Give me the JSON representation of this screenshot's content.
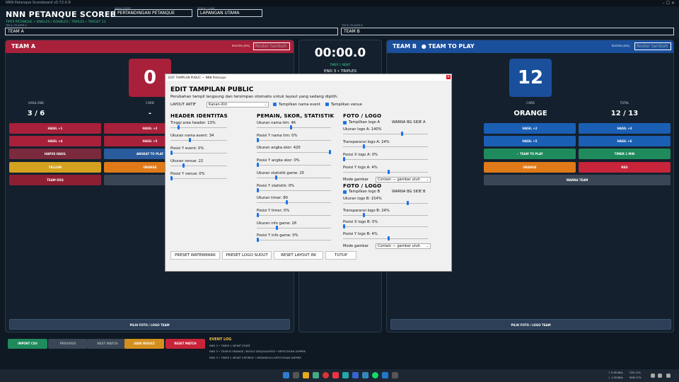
{
  "window": {
    "title": "NNN Petanque Scoreboard v0.72-0.8",
    "controls": "–  ☐  ✕"
  },
  "header": {
    "title": "NNN PETANQUE SCOREBOARD",
    "subtitle": "TIPEP PETANQUE • SINGLES / DOUBLES / TRIPLES • TARGET 13",
    "event_label": "NAMA EVENT",
    "event_value": "PERTANDINGAN PETANQUE",
    "venue_label": "VENUE / LANE",
    "venue_value": "LAPANGAN UTAMA",
    "team_a_label": "TIM A / PLAYER A",
    "team_a_value": "TEAM A",
    "team_b_label": "TIM B / PLAYER B",
    "team_b_value": "TEAM B"
  },
  "team_a": {
    "name": "TEAM A",
    "roster_label": "ROSTER (OPS)",
    "roster_placeholder": "Roster tambah",
    "score": "0",
    "stats": [
      {
        "label": "HASIL END",
        "value": "3 / 6"
      },
      {
        "label": "CARD",
        "value": "-"
      }
    ],
    "buttons": [
      "HASIL +1",
      "HASIL +2",
      "HASIL +4",
      "HASIL +5",
      "HAPUS HASIL",
      "ANGKAT TO PLAY",
      "YELLOW",
      "ORANGE",
      "TEAM DSQ"
    ],
    "photo_button": "PILIH FOTO / LOGO TEAM",
    "color": "#a8203a"
  },
  "team_b": {
    "name": "TEAM B",
    "to_play": "● TEAM TO PLAY",
    "roster_label": "ROSTER (OPS)",
    "roster_placeholder": "Roster tambah",
    "score": "12",
    "stats": [
      {
        "label": "CARD",
        "value": "ORANGE"
      },
      {
        "label": "TOTAL",
        "value": "12 / 13"
      }
    ],
    "buttons": [
      "HASIL +2",
      "HASIL +3",
      "HASIL +5",
      "HASIL +6",
      "✓ TEAM TO PLAY",
      "TIMER 1 MIN",
      "ORANGE",
      "RED",
      "WARNA TEAM"
    ],
    "photo_button": "PILIH FOTO / LOGO TEAM",
    "color": "#1a4f9c"
  },
  "center": {
    "timer": "00:00.0",
    "timer_sub": "TIMER 1 MENIT",
    "end_info": "END 3 • TRIPLES"
  },
  "bottom": {
    "buttons": [
      "IMPORT CSV",
      "PREVIOUS",
      "NEXT MATCH",
      "SAVE RESULT",
      "RESET MATCH"
    ],
    "log_title": "EVENT LOG",
    "log_lines": [
      "END 3 • TIMER 1 MENIT START",
      "END 3 • TEAM B ORANGE / BOULE DISQUALIFIED • KEPUTUSAN UMPIRE",
      "END 3 • TIMER 1 MENIT EXPIRED • MENUNGGU KEPUTUSAN UMPIRE"
    ]
  },
  "dialog": {
    "title": "EDIT TAMPILAN PUBLIC — NNN Petanque",
    "close": "✕",
    "heading": "EDIT TAMPILAN PUBLIC",
    "description": "Perubahan tampil langsung dan tersimpan otomatis untuk layout yang sedang dipilih.",
    "layout_label": "LAYOUT AKTIF",
    "layout_value": "Kanan–Kiri",
    "show_event": "Tampilkan nama event",
    "show_venue": "Tampilkan venue",
    "col1": {
      "heading": "HEADER IDENTITAS",
      "items": [
        {
          "label": "Tinggi area header: 13%",
          "level": 0.13
        },
        {
          "label": "Ukuran nama event: 34",
          "level": 0.34
        },
        {
          "label": "Posisi Y event: 0%",
          "level": 0.0
        },
        {
          "label": "Ukuran venue: 22",
          "level": 0.22
        },
        {
          "label": "Posisi Y venue: 0%",
          "level": 0.0
        }
      ]
    },
    "col2": {
      "heading": "PEMAIN, SKOR, STATISTIK",
      "items": [
        {
          "label": "Ukuran nama tim: 46",
          "level": 0.46
        },
        {
          "label": "Posisi Y nama tim: 0%",
          "level": 0.0
        },
        {
          "label": "Ukuran angka skor: 420",
          "level": 1.0
        },
        {
          "label": "Posisi Y angka skor: 0%",
          "level": 0.0
        },
        {
          "label": "Ukuran statistik game: 25",
          "level": 0.25
        },
        {
          "label": "Posisi Y statistik: 0%",
          "level": 0.0
        },
        {
          "label": "Ukuran timer: 80",
          "level": 0.4
        },
        {
          "label": "Posisi Y timer: 0%",
          "level": 0.0
        },
        {
          "label": "Ukuran info game: 26",
          "level": 0.26
        },
        {
          "label": "Posisi Y info game: 0%",
          "level": 0.0
        }
      ]
    },
    "col3a": {
      "heading": "FOTO / LOGO",
      "show_logo": "Tampilkan logo A",
      "bg_label": "WARNA BG SIDE A",
      "items": [
        {
          "label": "Ukuran logo A: 140%",
          "level": 0.7
        },
        {
          "label": "Transparansi logo A: 24%",
          "level": 0.24
        },
        {
          "label": "Posisi X logo A: 0%",
          "level": 0.0
        },
        {
          "label": "Posisi Y logo A: 4%",
          "level": 0.54
        }
      ],
      "mode_label": "Mode gambar",
      "mode_value": "Contain — gambar utuh"
    },
    "col3b": {
      "heading": "FOTO / LOGO",
      "show_logo": "Tampilkan logo B",
      "bg_label": "WARNA BG SIDE B",
      "items": [
        {
          "label": "Ukuran logo B: 154%",
          "level": 0.77
        },
        {
          "label": "Transparansi logo B: 24%",
          "level": 0.24
        },
        {
          "label": "Posisi X logo B: 0%",
          "level": 0.0
        },
        {
          "label": "Posisi Y logo B: 4%",
          "level": 0.54
        }
      ],
      "mode_label": "Mode gambar",
      "mode_value": "Contain — gambar utuh"
    },
    "buttons": [
      "PRESET WATERMARK",
      "PRESET LOGO SUDUT",
      "RESET LAYOUT INI",
      "TUTUP"
    ]
  },
  "taskbar": {
    "net_up": "↑ 5.98 KB/s",
    "net_down": "↓ 1.28 KB/s",
    "cpu": "CPU 11%",
    "ram": "RAM 27%"
  }
}
